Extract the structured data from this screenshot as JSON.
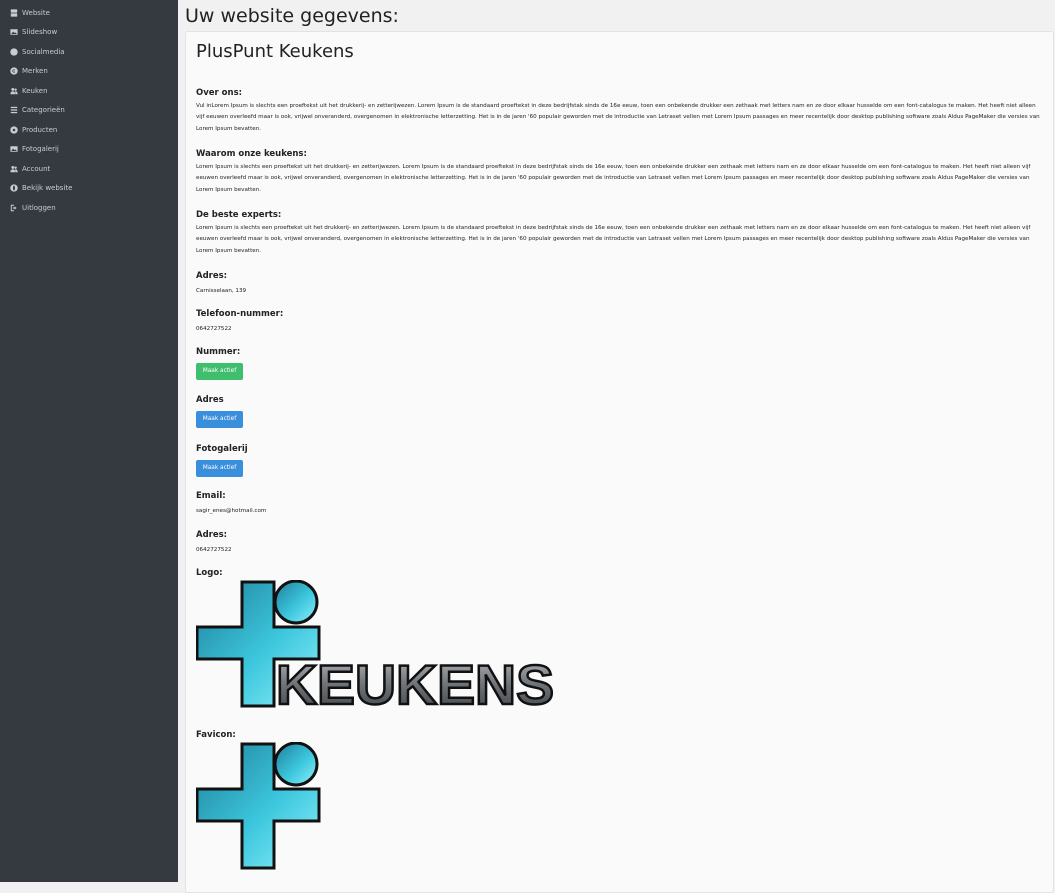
{
  "sidebar": {
    "items": [
      {
        "label": "Website",
        "icon": "server-icon"
      },
      {
        "label": "Slideshow",
        "icon": "image-icon"
      },
      {
        "label": "Socialmedia",
        "icon": "user-circle-icon"
      },
      {
        "label": "Merken",
        "icon": "copyright-icon"
      },
      {
        "label": "Keuken",
        "icon": "users-icon"
      },
      {
        "label": "Categorieën",
        "icon": "list-icon"
      },
      {
        "label": "Producten",
        "icon": "gear-icon"
      },
      {
        "label": "Fotogalerij",
        "icon": "image-icon"
      },
      {
        "label": "Account",
        "icon": "users-icon"
      },
      {
        "label": "Bekijk website",
        "icon": "globe-icon"
      },
      {
        "label": "Uitloggen",
        "icon": "sign-out-icon"
      }
    ]
  },
  "page": {
    "heading": "Uw website gegevens:",
    "site_name": "PlusPunt Keukens"
  },
  "sections": {
    "over_ons": {
      "heading": "Over ons:",
      "text": "Vul inLorem Ipsum is slechts een proeftekst uit het drukkerij- en zetterijwezen. Lorem Ipsum is de standaard proeftekst in deze bedrijfstak sinds de 16e eeuw, toen een onbekende drukker een zethaak met letters nam en ze door elkaar husselde om een font-catalogus te maken. Het heeft niet alleen vijf eeuwen overleefd maar is ook, vrijwel onveranderd, overgenomen in elektronische letterzetting. Het is in de jaren '60 populair geworden met de introductie van Letraset vellen met Lorem Ipsum passages en meer recentelijk door desktop publishing software zoals Aldus PageMaker die versies van Lorem Ipsum bevatten."
    },
    "waarom": {
      "heading": "Waarom onze keukens:",
      "text": "Lorem Ipsum is slechts een proeftekst uit het drukkerij- en zetterijwezen. Lorem Ipsum is de standaard proeftekst in deze bedrijfstak sinds de 16e eeuw, toen een onbekende drukker een zethaak met letters nam en ze door elkaar husselde om een font-catalogus te maken. Het heeft niet alleen vijf eeuwen overleefd maar is ook, vrijwel onveranderd, overgenomen in elektronische letterzetting. Het is in de jaren '60 populair geworden met de introductie van Letraset vellen met Lorem Ipsum passages en meer recentelijk door desktop publishing software zoals Aldus PageMaker die versies van Lorem Ipsum bevatten."
    },
    "experts": {
      "heading": "De beste experts:",
      "text": "Lorem Ipsum is slechts een proeftekst uit het drukkerij- en zetterijwezen. Lorem Ipsum is de standaard proeftekst in deze bedrijfstak sinds de 16e eeuw, toen een onbekende drukker een zethaak met letters nam en ze door elkaar husselde om een font-catalogus te maken. Het heeft niet alleen vijf eeuwen overleefd maar is ook, vrijwel onveranderd, overgenomen in elektronische letterzetting. Het is in de jaren '60 populair geworden met de introductie van Letraset vellen met Lorem Ipsum passages en meer recentelijk door desktop publishing software zoals Aldus PageMaker die versies van Lorem Ipsum bevatten."
    },
    "adres": {
      "heading": "Adres:",
      "value": "Carnisselaan, 139"
    },
    "telefoon": {
      "heading": "Telefoon-nummer:",
      "value": "0642727522"
    },
    "nummer": {
      "heading": "Nummer:",
      "button": "Maak actief",
      "button_color": "#3fbf6e"
    },
    "adres_toggle": {
      "heading": "Adres",
      "button": "Maak actief",
      "button_color": "#3a8fdc"
    },
    "fotogalerij": {
      "heading": "Fotogalerij",
      "button": "Maak actief",
      "button_color": "#3a8fdc"
    },
    "email": {
      "heading": "Email:",
      "value": "sagir_enes@hotmail.com"
    },
    "adres2": {
      "heading": "Adres:",
      "value": "0642727522"
    },
    "logo": {
      "heading": "Logo:",
      "text": "KEUKENS"
    },
    "favicon": {
      "heading": "Favicon:"
    }
  },
  "colors": {
    "sidebar_bg": "#343a40",
    "logo_cyan": "#29b3cc",
    "logo_grey": "#555a60"
  }
}
